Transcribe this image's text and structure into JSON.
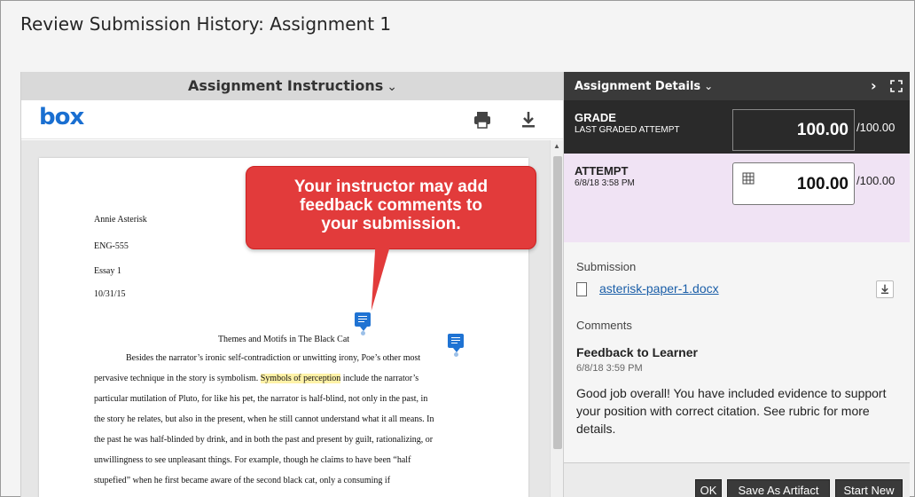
{
  "page": {
    "title": "Review Submission History: Assignment 1"
  },
  "instructions": {
    "header_label": "Assignment Instructions",
    "chevron": "chevron-down-icon",
    "viewer_logo": "box",
    "tools": [
      "print-icon",
      "download-icon"
    ]
  },
  "document": {
    "header_lines": [
      "Annie Asterisk",
      "ENG-555",
      "Essay 1",
      "10/31/15"
    ],
    "heading": "Themes and Motifs in The Black Cat",
    "paragraph_lines": [
      "Besides the narrator’s ironic self-contradiction or unwitting irony, Poe’s other most",
      "pervasive technique in the story is symbolism.",
      "Symbols of perception",
      " include the narrator’s",
      "particular mutilation of Pluto, for like his pet, the narrator is half-blind, not only in the past, in",
      "the story he relates, but also in the present, when he still cannot understand what it all means. In",
      "the past he was half-blinded by drink, and in both the past and present by guilt, rationalizing, or",
      "unwillingness to see unpleasant things. For example, though he claims to have been “half",
      "stupefied” when he first became aware of the second black cat, only a consuming if"
    ]
  },
  "callout": {
    "lines": [
      "Your instructor may add",
      "feedback comments to",
      "your submission."
    ],
    "color": "#e23b3b"
  },
  "details": {
    "header_label": "Assignment Details",
    "next_icon": "chevron-right-icon",
    "expand_icon": "expand-icon",
    "grade": {
      "title": "GRADE",
      "subtitle": "LAST GRADED ATTEMPT",
      "value": "100.00",
      "max": "/100.00"
    },
    "attempt": {
      "title": "ATTEMPT",
      "date": "6/8/18 3:58 PM",
      "value": "100.00",
      "max": "/100.00"
    },
    "submission": {
      "label": "Submission",
      "file_name": "asterisk-paper-1.docx"
    },
    "comments": {
      "label": "Comments",
      "title": "Feedback to Learner",
      "date": "6/8/18 3:59 PM",
      "text": "Good job overall! You have included evidence to support your position with correct citation. See rubric for more details."
    }
  },
  "footer": {
    "ok_label": "OK",
    "artifact_label": "Save As Artifact",
    "new_label": "Start New"
  }
}
